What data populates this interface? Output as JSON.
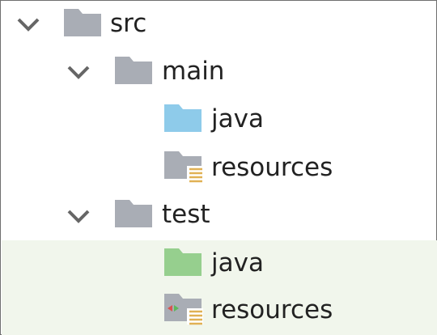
{
  "tree": {
    "nodes": [
      {
        "label": "src",
        "icon": "folder-gray",
        "expanded": true
      },
      {
        "label": "main",
        "icon": "folder-gray",
        "expanded": true
      },
      {
        "label": "java",
        "icon": "folder-blue-sources"
      },
      {
        "label": "resources",
        "icon": "folder-resources"
      },
      {
        "label": "test",
        "icon": "folder-gray",
        "expanded": true
      },
      {
        "label": "java",
        "icon": "folder-green-test-sources"
      },
      {
        "label": "resources",
        "icon": "folder-test-resources"
      }
    ]
  },
  "colors": {
    "folder_gray": "#a9adb5",
    "folder_blue": "#8ecbea",
    "folder_green": "#96cf8e",
    "highlight": "#f1f6ec",
    "resource_lines": "#e0b154",
    "chevron": "#666666"
  }
}
